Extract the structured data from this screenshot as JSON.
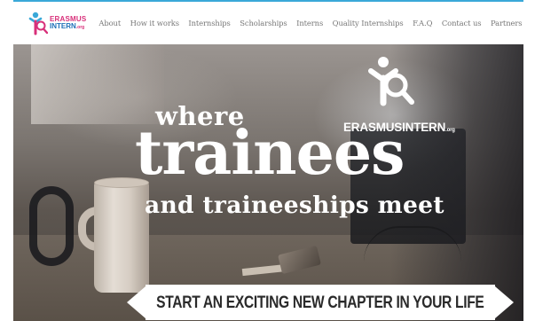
{
  "brand": {
    "name_line1": "ERASMUS",
    "name_line2": "INTERN",
    "name_suffix": ".org",
    "accent": "#d8307a",
    "secondary": "#1d6fb8"
  },
  "nav": {
    "items": [
      {
        "label": "About"
      },
      {
        "label": "How it works"
      },
      {
        "label": "Internships"
      },
      {
        "label": "Scholarships"
      },
      {
        "label": "Interns"
      },
      {
        "label": "Quality Internships"
      },
      {
        "label": "F.A.Q"
      },
      {
        "label": "Contact us"
      },
      {
        "label": "Partners"
      }
    ]
  },
  "hero": {
    "headline_where": "where",
    "headline_trainees": "trainees",
    "headline_meet": "and traineeships meet",
    "brand_text": "ERASMUSINTERN",
    "brand_suffix": ".org",
    "banner": "START AN EXCITING NEW CHAPTER IN YOUR LIFE"
  }
}
